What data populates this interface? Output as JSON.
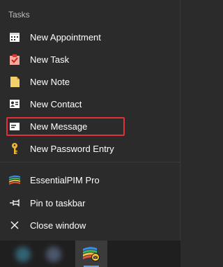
{
  "jumplist": {
    "section_title": "Tasks",
    "tasks": [
      {
        "label": "New Appointment",
        "icon": "calendar-icon"
      },
      {
        "label": "New Task",
        "icon": "task-checkbox-icon"
      },
      {
        "label": "New Note",
        "icon": "note-icon"
      },
      {
        "label": "New Contact",
        "icon": "contact-card-icon"
      },
      {
        "label": "New Message",
        "icon": "message-icon"
      },
      {
        "label": "New Password Entry",
        "icon": "key-icon"
      }
    ],
    "app": {
      "label": "EssentialPIM Pro",
      "icon": "essentialpim-logo-icon"
    },
    "pin": {
      "label": "Pin to taskbar",
      "icon": "pin-icon"
    },
    "close": {
      "label": "Close window",
      "icon": "close-icon"
    }
  },
  "colors": {
    "background": "#2b2b2b",
    "highlight_border": "#e0303a",
    "taskbar": "#1f1f1f"
  }
}
